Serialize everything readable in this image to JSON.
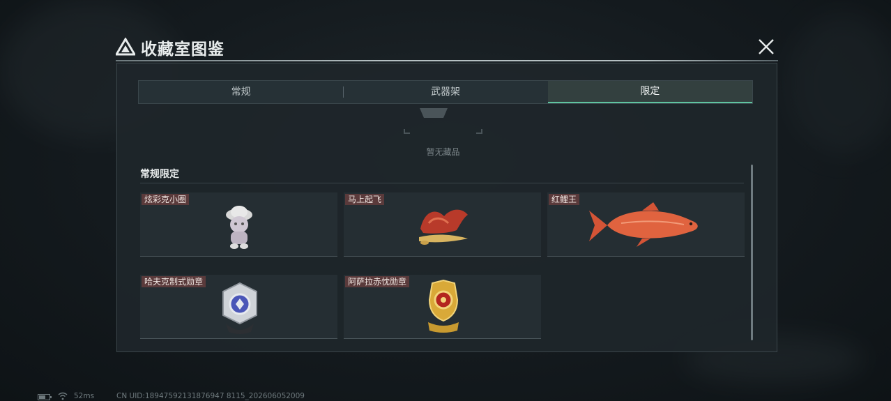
{
  "header": {
    "title": "收藏室图鉴"
  },
  "tabs": [
    {
      "label": "常规",
      "active": false
    },
    {
      "label": "武器架",
      "active": false
    },
    {
      "label": "限定",
      "active": true
    }
  ],
  "empty_state": {
    "text": "暂无藏品"
  },
  "section": {
    "title": "常规限定",
    "items": [
      {
        "label": "炫彩克小圈",
        "icon": "plush-figure-icon"
      },
      {
        "label": "马上起飞",
        "icon": "red-horse-statue-icon"
      },
      {
        "label": "红鲤王",
        "icon": "red-carp-icon"
      },
      {
        "label": "哈夫克制式勋章",
        "icon": "silver-medal-icon"
      },
      {
        "label": "阿萨拉赤忱勋章",
        "icon": "gold-medal-icon"
      }
    ]
  },
  "status_bar": {
    "ping": "52ms",
    "uid": "CN UID:18947592131876947 8115_202606052009"
  },
  "colors": {
    "accent": "#5fc4a0",
    "label_bg": "#5a3a3b",
    "panel_bg": "#1e262a"
  }
}
